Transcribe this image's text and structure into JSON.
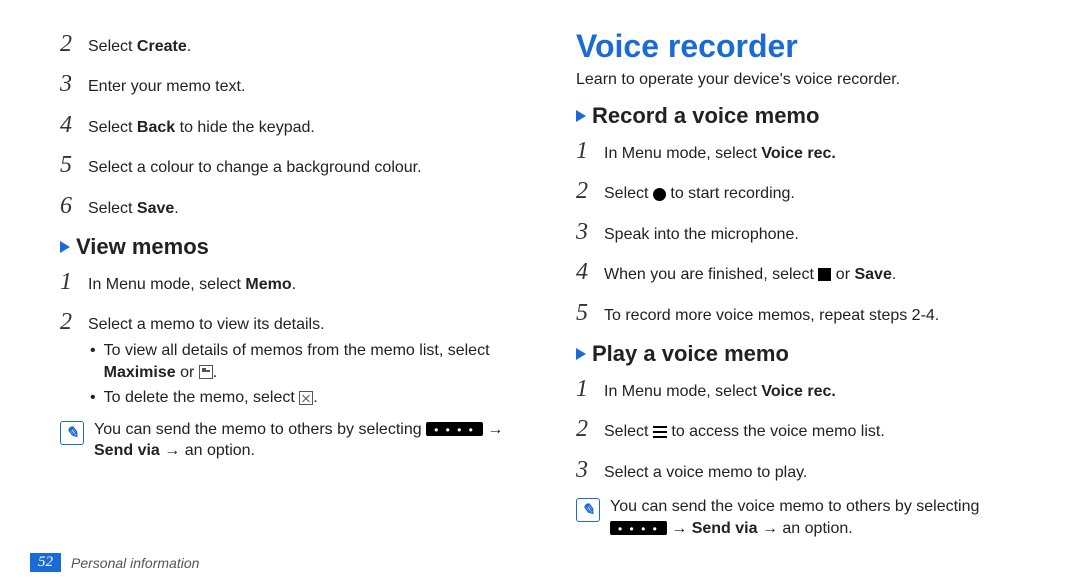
{
  "left": {
    "steps_top": [
      {
        "n": "2",
        "segs": [
          "Select ",
          {
            "b": "Create"
          },
          "."
        ]
      },
      {
        "n": "3",
        "segs": [
          "Enter your memo text."
        ]
      },
      {
        "n": "4",
        "segs": [
          "Select ",
          {
            "b": "Back"
          },
          " to hide the keypad."
        ]
      },
      {
        "n": "5",
        "segs": [
          "Select a colour to change a background colour."
        ]
      },
      {
        "n": "6",
        "segs": [
          "Select ",
          {
            "b": "Save"
          },
          "."
        ]
      }
    ],
    "sub1": "View memos",
    "view_steps": [
      {
        "n": "1",
        "segs": [
          "In Menu mode, select ",
          {
            "b": "Memo"
          },
          "."
        ]
      },
      {
        "n": "2",
        "segs": [
          "Select a memo to view its details."
        ],
        "inner": [
          {
            "segs": [
              "To view all details of memos from the memo list, select ",
              {
                "b": "Maximise"
              },
              " or ",
              {
                "ico": "maximise"
              },
              "."
            ]
          },
          {
            "segs": [
              "To delete the memo, select ",
              {
                "ico": "delete"
              },
              "."
            ]
          }
        ]
      }
    ],
    "note": {
      "segs": [
        "You can send the memo to others by selecting ",
        {
          "ico": "sendvia"
        },
        " → ",
        {
          "b": "Send via"
        },
        " → an option."
      ]
    }
  },
  "right": {
    "title": "Voice recorder",
    "lead": "Learn to operate your device's voice recorder.",
    "sub1": "Record a voice memo",
    "rec_steps": [
      {
        "n": "1",
        "segs": [
          "In Menu mode, select ",
          {
            "b": "Voice rec."
          }
        ]
      },
      {
        "n": "2",
        "segs": [
          "Select ",
          {
            "ico": "circle"
          },
          " to start recording."
        ]
      },
      {
        "n": "3",
        "segs": [
          "Speak into the microphone."
        ]
      },
      {
        "n": "4",
        "segs": [
          "When you are finished, select ",
          {
            "ico": "square"
          },
          " or ",
          {
            "b": "Save"
          },
          "."
        ]
      },
      {
        "n": "5",
        "segs": [
          "To record more voice memos, repeat steps 2-4."
        ]
      }
    ],
    "sub2": "Play a voice memo",
    "play_steps": [
      {
        "n": "1",
        "segs": [
          "In Menu mode, select ",
          {
            "b": "Voice rec."
          }
        ]
      },
      {
        "n": "2",
        "segs": [
          "Select ",
          {
            "ico": "list"
          },
          " to access the voice memo list."
        ]
      },
      {
        "n": "3",
        "segs": [
          "Select a voice memo to play."
        ]
      }
    ],
    "note": {
      "segs": [
        "You can send the voice memo to others by selecting ",
        {
          "ico": "sendvia"
        },
        " → ",
        {
          "b": "Send via"
        },
        " → an option."
      ]
    }
  },
  "footer": {
    "page": "52",
    "section": "Personal information"
  }
}
